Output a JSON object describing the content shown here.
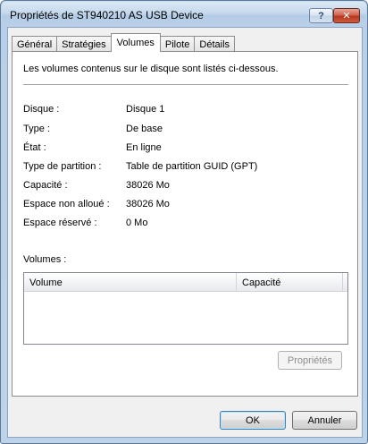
{
  "window": {
    "title": "Propriétés de ST940210 AS USB Device",
    "help_label": "?",
    "close_label": "✕"
  },
  "tabs": [
    {
      "label": "Général",
      "active": false
    },
    {
      "label": "Stratégies",
      "active": false
    },
    {
      "label": "Volumes",
      "active": true
    },
    {
      "label": "Pilote",
      "active": false
    },
    {
      "label": "Détails",
      "active": false
    }
  ],
  "panel": {
    "intro": "Les volumes contenus sur le disque sont listés ci-dessous.",
    "properties": [
      {
        "label": "Disque :",
        "value": "Disque 1"
      },
      {
        "label": "Type :",
        "value": "De base"
      },
      {
        "label": "État :",
        "value": "En ligne"
      },
      {
        "label": "Type de partition :",
        "value": "Table de partition GUID (GPT)"
      },
      {
        "label": "Capacité :",
        "value": "38026 Mo"
      },
      {
        "label": "Espace non alloué :",
        "value": "38026 Mo"
      },
      {
        "label": "Espace réservé :",
        "value": "0 Mo"
      }
    ],
    "volumes_label": "Volumes :",
    "columns": [
      "Volume",
      "Capacité"
    ],
    "rows": [],
    "properties_button": "Propriétés"
  },
  "footer": {
    "ok_label": "OK",
    "cancel_label": "Annuler"
  }
}
